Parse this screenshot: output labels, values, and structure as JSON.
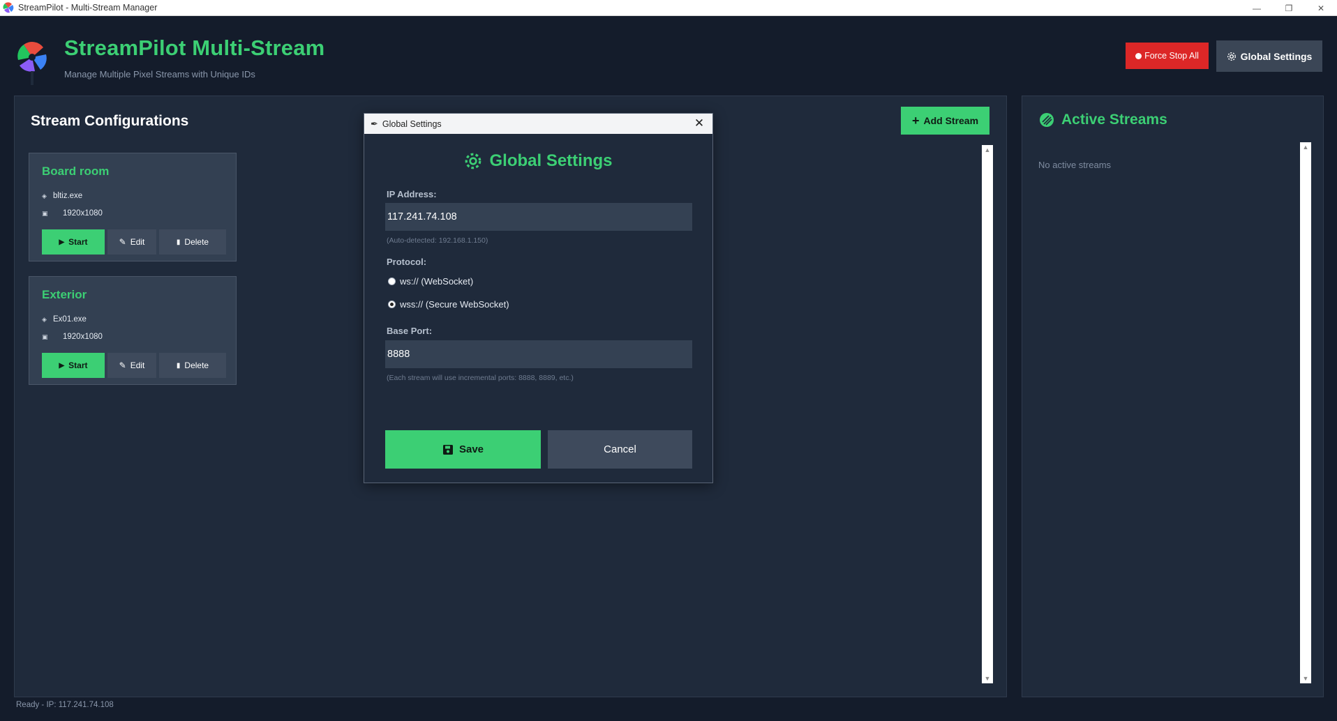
{
  "window": {
    "title": "StreamPilot - Multi-Stream Manager",
    "controls": [
      "minimize-icon",
      "restore-icon",
      "close-icon"
    ]
  },
  "header": {
    "title": "StreamPilot Multi-Stream",
    "subtitle": "Manage Multiple Pixel Streams with Unique IDs",
    "force_stop_label": "Force Stop All",
    "global_settings_label": "Global Settings"
  },
  "configs": {
    "title": "Stream Configurations",
    "add_label": "Add Stream",
    "streams": [
      {
        "name": "Board room",
        "exe": "bltiz.exe",
        "resolution": "1920x1080",
        "start": "Start",
        "edit": "Edit",
        "delete": "Delete"
      },
      {
        "name": "Exterior",
        "exe": "Ex01.exe",
        "resolution": "1920x1080",
        "start": "Start",
        "edit": "Edit",
        "delete": "Delete"
      }
    ]
  },
  "active": {
    "title": "Active Streams",
    "empty_text": "No active streams"
  },
  "status": {
    "text": "Ready - IP: 117.241.74.108"
  },
  "dialog": {
    "window_title": "Global Settings",
    "heading": "Global Settings",
    "ip_label": "IP Address:",
    "ip_value": "117.241.74.108",
    "ip_hint": "(Auto-detected: 192.168.1.150)",
    "protocol_label": "Protocol:",
    "protocol_options": [
      {
        "label": "ws:// (WebSocket)",
        "selected": false
      },
      {
        "label": "wss:// (Secure WebSocket)",
        "selected": true
      }
    ],
    "port_label": "Base Port:",
    "port_value": "8888",
    "port_hint": "(Each stream will use incremental ports: 8888, 8889, etc.)",
    "save_label": "Save",
    "cancel_label": "Cancel"
  },
  "colors": {
    "accent": "#3ccf74",
    "danger": "#dc2727",
    "background": "#141c2b",
    "panel": "#1f2a3b",
    "card": "#334052"
  }
}
